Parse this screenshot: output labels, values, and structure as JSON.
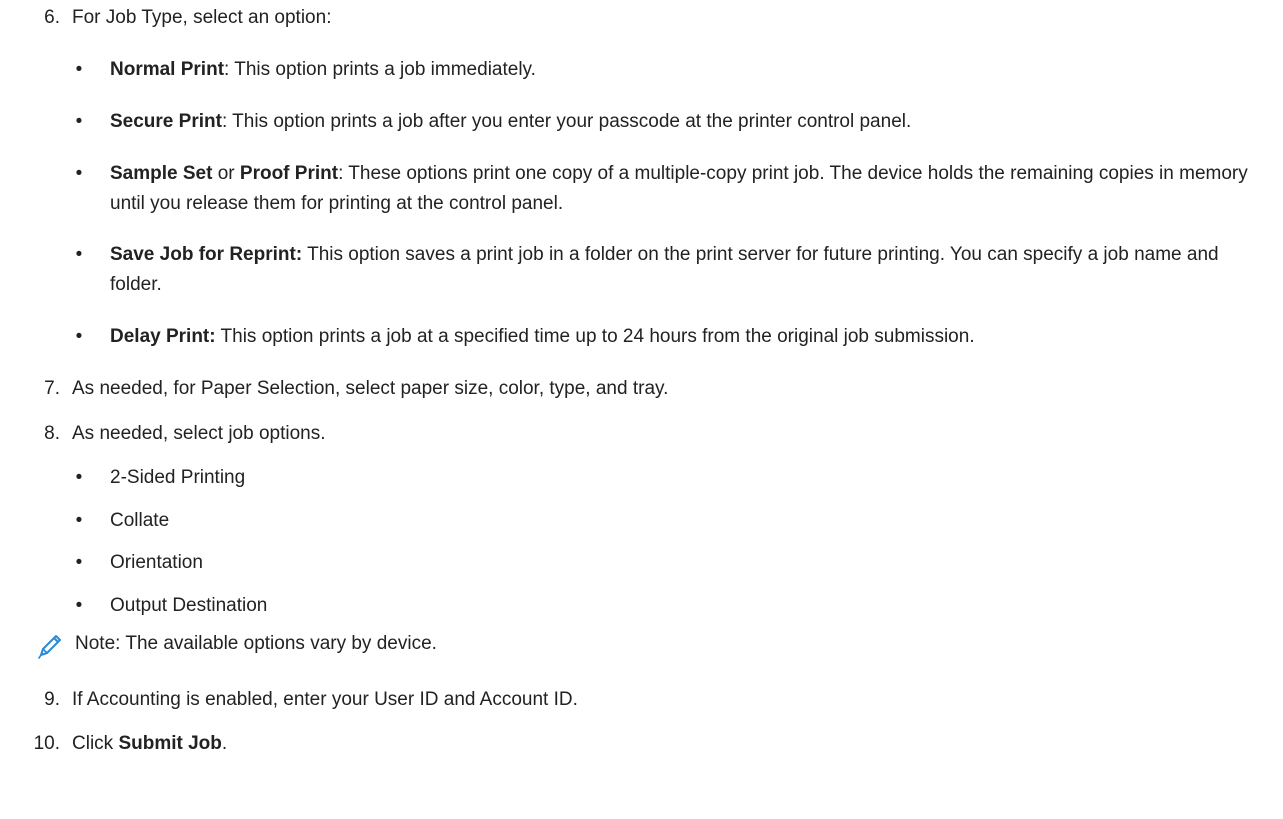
{
  "steps": [
    {
      "number": "6.",
      "text": "For Job Type, select an option:"
    },
    {
      "number": "7.",
      "text": "As needed, for Paper Selection, select paper size, color, type, and tray."
    },
    {
      "number": "8.",
      "text": "As needed, select job options."
    },
    {
      "number": "9.",
      "text": "If Accounting is enabled, enter your User ID and Account ID."
    },
    {
      "number": "10.",
      "pre": "Click ",
      "bold": "Submit Job",
      "post": "."
    }
  ],
  "job_types": [
    {
      "bold": "Normal Print",
      "text": ": This option prints a job immediately."
    },
    {
      "bold": "Secure Print",
      "text": ": This option prints a job after you enter your passcode at the printer control panel."
    },
    {
      "bold": "Sample Set",
      "mid": " or ",
      "bold2": "Proof Print",
      "text": ": These options print one copy of a multiple-copy print job. The device holds the remaining copies in memory until you release them for printing at the control panel."
    },
    {
      "bold": "Save Job for Reprint:",
      "text": " This option saves a print job in a folder on the print server for future printing. You can specify a job name and folder."
    },
    {
      "bold": "Delay Print:",
      "text": " This option prints a job at a specified time up to 24 hours from the original job submission."
    }
  ],
  "job_options": [
    "2-Sided Printing",
    "Collate",
    "Orientation",
    "Output Destination"
  ],
  "note": {
    "text": "Note: The available options vary by device.",
    "icon": "pencil-icon",
    "icon_color": "#2a8ad4"
  },
  "bullet_char": "•"
}
